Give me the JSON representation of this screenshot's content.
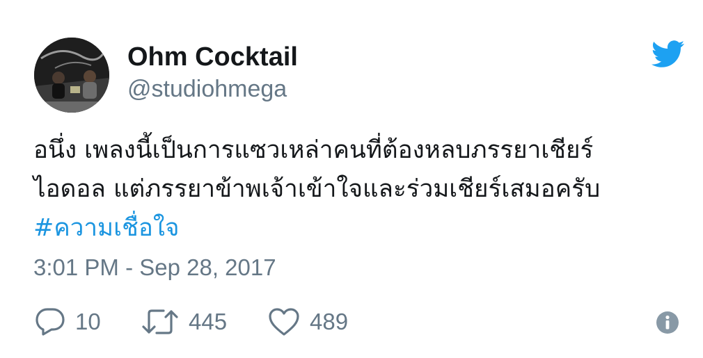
{
  "tweet": {
    "author": {
      "display_name": "Ohm Cocktail",
      "handle": "@studiohmega",
      "avatar_icon": "profile-photo"
    },
    "text_lines": [
      "อนึ่ง เพลงนี้เป็นการแซวเหล่าคนที่ต้องหลบภรรยาเชียร์",
      "ไอดอล แต่ภรรยาข้าพเจ้าเข้าใจและร่วมเชียร์เสมอครับ"
    ],
    "hashtag": "#ความเชื่อใจ",
    "timestamp": "3:01 PM - Sep 28, 2017",
    "actions": {
      "reply_count": "10",
      "retweet_count": "445",
      "like_count": "489"
    }
  },
  "icons": {
    "brand": "twitter-bird-icon",
    "reply": "reply-icon",
    "retweet": "retweet-icon",
    "like": "heart-icon",
    "info": "info-icon"
  },
  "colors": {
    "brand": "#1da1f2",
    "hashtag": "#1b95e0",
    "secondary_text": "#657786",
    "primary_text": "#14171a"
  }
}
